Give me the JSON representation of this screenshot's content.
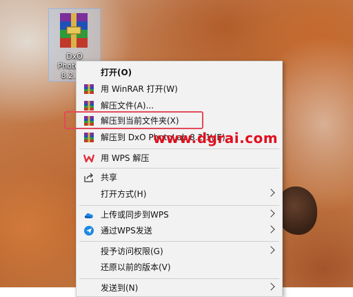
{
  "desktop": {
    "icon_label": "DxO\nPhotoL…\n8.2.1..."
  },
  "menu": {
    "items": [
      {
        "label": "打开(O)",
        "icon": "none",
        "bold": true
      },
      {
        "label": "用 WinRAR 打开(W)",
        "icon": "winrar-icon"
      },
      {
        "label": "解压文件(A)...",
        "icon": "winrar-icon"
      },
      {
        "label": "解压到当前文件夹(X)",
        "icon": "winrar-icon"
      },
      {
        "label": "解压到 DxO PhotoLab 8.2.1\\(E)",
        "icon": "winrar-icon"
      },
      {
        "label": "用 WPS 解压",
        "icon": "wps-icon"
      },
      {
        "label": "共享",
        "icon": "share-icon"
      },
      {
        "label": "打开方式(H)",
        "icon": "none",
        "submenu": true
      },
      {
        "label": "上传或同步到WPS",
        "icon": "cloud-icon",
        "submenu": true
      },
      {
        "label": "通过WPS发送",
        "icon": "send-icon",
        "submenu": true
      },
      {
        "label": "授予访问权限(G)",
        "icon": "none",
        "submenu": true
      },
      {
        "label": "还原以前的版本(V)",
        "icon": "none"
      },
      {
        "label": "发送到(N)",
        "icon": "none",
        "submenu": true
      }
    ]
  },
  "watermark": "www.dgrai.com",
  "colors": {
    "highlight": "#e14a5a",
    "watermark": "#e0101f",
    "menu_bg": "#f2f2f2"
  }
}
